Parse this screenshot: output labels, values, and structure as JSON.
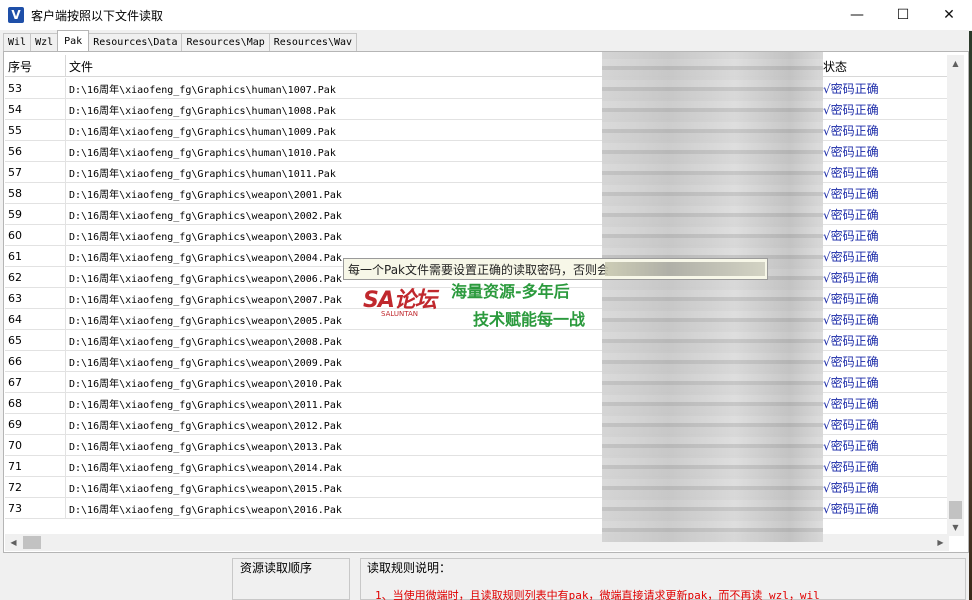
{
  "window": {
    "title": "客户端按照以下文件读取",
    "icon_letter": "V",
    "minimize": "—",
    "maximize": "☐",
    "close": "✕"
  },
  "tabs": [
    "Wil",
    "Wzl",
    "Pak",
    "Resources\\Data",
    "Resources\\Map",
    "Resources\\Wav"
  ],
  "active_tab": "Pak",
  "table": {
    "headers": {
      "no": "序号",
      "file": "文件",
      "status": "状态"
    },
    "rows": [
      {
        "no": "53",
        "file": "D:\\16周年\\xiaofeng_fg\\Graphics\\human\\1007.Pak",
        "status": "√密码正确"
      },
      {
        "no": "54",
        "file": "D:\\16周年\\xiaofeng_fg\\Graphics\\human\\1008.Pak",
        "status": "√密码正确"
      },
      {
        "no": "55",
        "file": "D:\\16周年\\xiaofeng_fg\\Graphics\\human\\1009.Pak",
        "status": "√密码正确"
      },
      {
        "no": "56",
        "file": "D:\\16周年\\xiaofeng_fg\\Graphics\\human\\1010.Pak",
        "status": "√密码正确"
      },
      {
        "no": "57",
        "file": "D:\\16周年\\xiaofeng_fg\\Graphics\\human\\1011.Pak",
        "status": "√密码正确"
      },
      {
        "no": "58",
        "file": "D:\\16周年\\xiaofeng_fg\\Graphics\\weapon\\2001.Pak",
        "status": "√密码正确"
      },
      {
        "no": "59",
        "file": "D:\\16周年\\xiaofeng_fg\\Graphics\\weapon\\2002.Pak",
        "status": "√密码正确"
      },
      {
        "no": "60",
        "file": "D:\\16周年\\xiaofeng_fg\\Graphics\\weapon\\2003.Pak",
        "status": "√密码正确"
      },
      {
        "no": "61",
        "file": "D:\\16周年\\xiaofeng_fg\\Graphics\\weapon\\2004.Pak",
        "status": "√密码正确"
      },
      {
        "no": "62",
        "file": "D:\\16周年\\xiaofeng_fg\\Graphics\\weapon\\2006.Pak",
        "status": "√密码正确"
      },
      {
        "no": "63",
        "file": "D:\\16周年\\xiaofeng_fg\\Graphics\\weapon\\2007.Pak",
        "status": "√密码正确"
      },
      {
        "no": "64",
        "file": "D:\\16周年\\xiaofeng_fg\\Graphics\\weapon\\2005.Pak",
        "status": "√密码正确"
      },
      {
        "no": "65",
        "file": "D:\\16周年\\xiaofeng_fg\\Graphics\\weapon\\2008.Pak",
        "status": "√密码正确"
      },
      {
        "no": "66",
        "file": "D:\\16周年\\xiaofeng_fg\\Graphics\\weapon\\2009.Pak",
        "status": "√密码正确"
      },
      {
        "no": "67",
        "file": "D:\\16周年\\xiaofeng_fg\\Graphics\\weapon\\2010.Pak",
        "status": "√密码正确"
      },
      {
        "no": "68",
        "file": "D:\\16周年\\xiaofeng_fg\\Graphics\\weapon\\2011.Pak",
        "status": "√密码正确"
      },
      {
        "no": "69",
        "file": "D:\\16周年\\xiaofeng_fg\\Graphics\\weapon\\2012.Pak",
        "status": "√密码正确"
      },
      {
        "no": "70",
        "file": "D:\\16周年\\xiaofeng_fg\\Graphics\\weapon\\2013.Pak",
        "status": "√密码正确"
      },
      {
        "no": "71",
        "file": "D:\\16周年\\xiaofeng_fg\\Graphics\\weapon\\2014.Pak",
        "status": "√密码正确"
      },
      {
        "no": "72",
        "file": "D:\\16周年\\xiaofeng_fg\\Graphics\\weapon\\2015.Pak",
        "status": "√密码正确"
      },
      {
        "no": "73",
        "file": "D:\\16周年\\xiaofeng_fg\\Graphics\\weapon\\2016.Pak",
        "status": "√密码正确"
      }
    ]
  },
  "tooltip": "每一个Pak文件需要设置正确的读取密码，否则会",
  "watermark": {
    "logo": "SA论坛",
    "sub": "SALUNTAN",
    "line1": "海量资源-多年后",
    "line2": "技术赋能每一战"
  },
  "bottom": {
    "order_label": "资源读取顺序",
    "rules_label": "读取规则说明：",
    "rule_1": "1、当使用微端时，且读取规则列表中有pak，微端直接请求更新pak，而不再读 wzl，wil"
  },
  "colors": {
    "status_text": "#1a2aa8",
    "rule_text": "#e00000",
    "watermark_red": "#c0282d",
    "watermark_green": "#2b9a3d"
  }
}
